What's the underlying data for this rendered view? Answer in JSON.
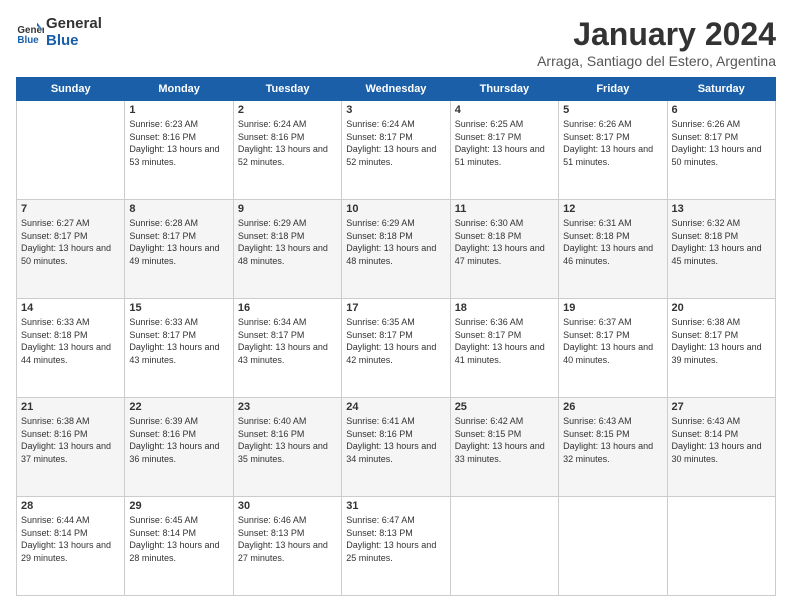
{
  "logo": {
    "line1": "General",
    "line2": "Blue"
  },
  "title": "January 2024",
  "subtitle": "Arraga, Santiago del Estero, Argentina",
  "days_header": [
    "Sunday",
    "Monday",
    "Tuesday",
    "Wednesday",
    "Thursday",
    "Friday",
    "Saturday"
  ],
  "weeks": [
    [
      {
        "day": "",
        "info": ""
      },
      {
        "day": "1",
        "info": "Sunrise: 6:23 AM\nSunset: 8:16 PM\nDaylight: 13 hours\nand 53 minutes."
      },
      {
        "day": "2",
        "info": "Sunrise: 6:24 AM\nSunset: 8:16 PM\nDaylight: 13 hours\nand 52 minutes."
      },
      {
        "day": "3",
        "info": "Sunrise: 6:24 AM\nSunset: 8:17 PM\nDaylight: 13 hours\nand 52 minutes."
      },
      {
        "day": "4",
        "info": "Sunrise: 6:25 AM\nSunset: 8:17 PM\nDaylight: 13 hours\nand 51 minutes."
      },
      {
        "day": "5",
        "info": "Sunrise: 6:26 AM\nSunset: 8:17 PM\nDaylight: 13 hours\nand 51 minutes."
      },
      {
        "day": "6",
        "info": "Sunrise: 6:26 AM\nSunset: 8:17 PM\nDaylight: 13 hours\nand 50 minutes."
      }
    ],
    [
      {
        "day": "7",
        "info": "Sunrise: 6:27 AM\nSunset: 8:17 PM\nDaylight: 13 hours\nand 50 minutes."
      },
      {
        "day": "8",
        "info": "Sunrise: 6:28 AM\nSunset: 8:17 PM\nDaylight: 13 hours\nand 49 minutes."
      },
      {
        "day": "9",
        "info": "Sunrise: 6:29 AM\nSunset: 8:18 PM\nDaylight: 13 hours\nand 48 minutes."
      },
      {
        "day": "10",
        "info": "Sunrise: 6:29 AM\nSunset: 8:18 PM\nDaylight: 13 hours\nand 48 minutes."
      },
      {
        "day": "11",
        "info": "Sunrise: 6:30 AM\nSunset: 8:18 PM\nDaylight: 13 hours\nand 47 minutes."
      },
      {
        "day": "12",
        "info": "Sunrise: 6:31 AM\nSunset: 8:18 PM\nDaylight: 13 hours\nand 46 minutes."
      },
      {
        "day": "13",
        "info": "Sunrise: 6:32 AM\nSunset: 8:18 PM\nDaylight: 13 hours\nand 45 minutes."
      }
    ],
    [
      {
        "day": "14",
        "info": "Sunrise: 6:33 AM\nSunset: 8:18 PM\nDaylight: 13 hours\nand 44 minutes."
      },
      {
        "day": "15",
        "info": "Sunrise: 6:33 AM\nSunset: 8:17 PM\nDaylight: 13 hours\nand 43 minutes."
      },
      {
        "day": "16",
        "info": "Sunrise: 6:34 AM\nSunset: 8:17 PM\nDaylight: 13 hours\nand 43 minutes."
      },
      {
        "day": "17",
        "info": "Sunrise: 6:35 AM\nSunset: 8:17 PM\nDaylight: 13 hours\nand 42 minutes."
      },
      {
        "day": "18",
        "info": "Sunrise: 6:36 AM\nSunset: 8:17 PM\nDaylight: 13 hours\nand 41 minutes."
      },
      {
        "day": "19",
        "info": "Sunrise: 6:37 AM\nSunset: 8:17 PM\nDaylight: 13 hours\nand 40 minutes."
      },
      {
        "day": "20",
        "info": "Sunrise: 6:38 AM\nSunset: 8:17 PM\nDaylight: 13 hours\nand 39 minutes."
      }
    ],
    [
      {
        "day": "21",
        "info": "Sunrise: 6:38 AM\nSunset: 8:16 PM\nDaylight: 13 hours\nand 37 minutes."
      },
      {
        "day": "22",
        "info": "Sunrise: 6:39 AM\nSunset: 8:16 PM\nDaylight: 13 hours\nand 36 minutes."
      },
      {
        "day": "23",
        "info": "Sunrise: 6:40 AM\nSunset: 8:16 PM\nDaylight: 13 hours\nand 35 minutes."
      },
      {
        "day": "24",
        "info": "Sunrise: 6:41 AM\nSunset: 8:16 PM\nDaylight: 13 hours\nand 34 minutes."
      },
      {
        "day": "25",
        "info": "Sunrise: 6:42 AM\nSunset: 8:15 PM\nDaylight: 13 hours\nand 33 minutes."
      },
      {
        "day": "26",
        "info": "Sunrise: 6:43 AM\nSunset: 8:15 PM\nDaylight: 13 hours\nand 32 minutes."
      },
      {
        "day": "27",
        "info": "Sunrise: 6:43 AM\nSunset: 8:14 PM\nDaylight: 13 hours\nand 30 minutes."
      }
    ],
    [
      {
        "day": "28",
        "info": "Sunrise: 6:44 AM\nSunset: 8:14 PM\nDaylight: 13 hours\nand 29 minutes."
      },
      {
        "day": "29",
        "info": "Sunrise: 6:45 AM\nSunset: 8:14 PM\nDaylight: 13 hours\nand 28 minutes."
      },
      {
        "day": "30",
        "info": "Sunrise: 6:46 AM\nSunset: 8:13 PM\nDaylight: 13 hours\nand 27 minutes."
      },
      {
        "day": "31",
        "info": "Sunrise: 6:47 AM\nSunset: 8:13 PM\nDaylight: 13 hours\nand 25 minutes."
      },
      {
        "day": "",
        "info": ""
      },
      {
        "day": "",
        "info": ""
      },
      {
        "day": "",
        "info": ""
      }
    ]
  ]
}
